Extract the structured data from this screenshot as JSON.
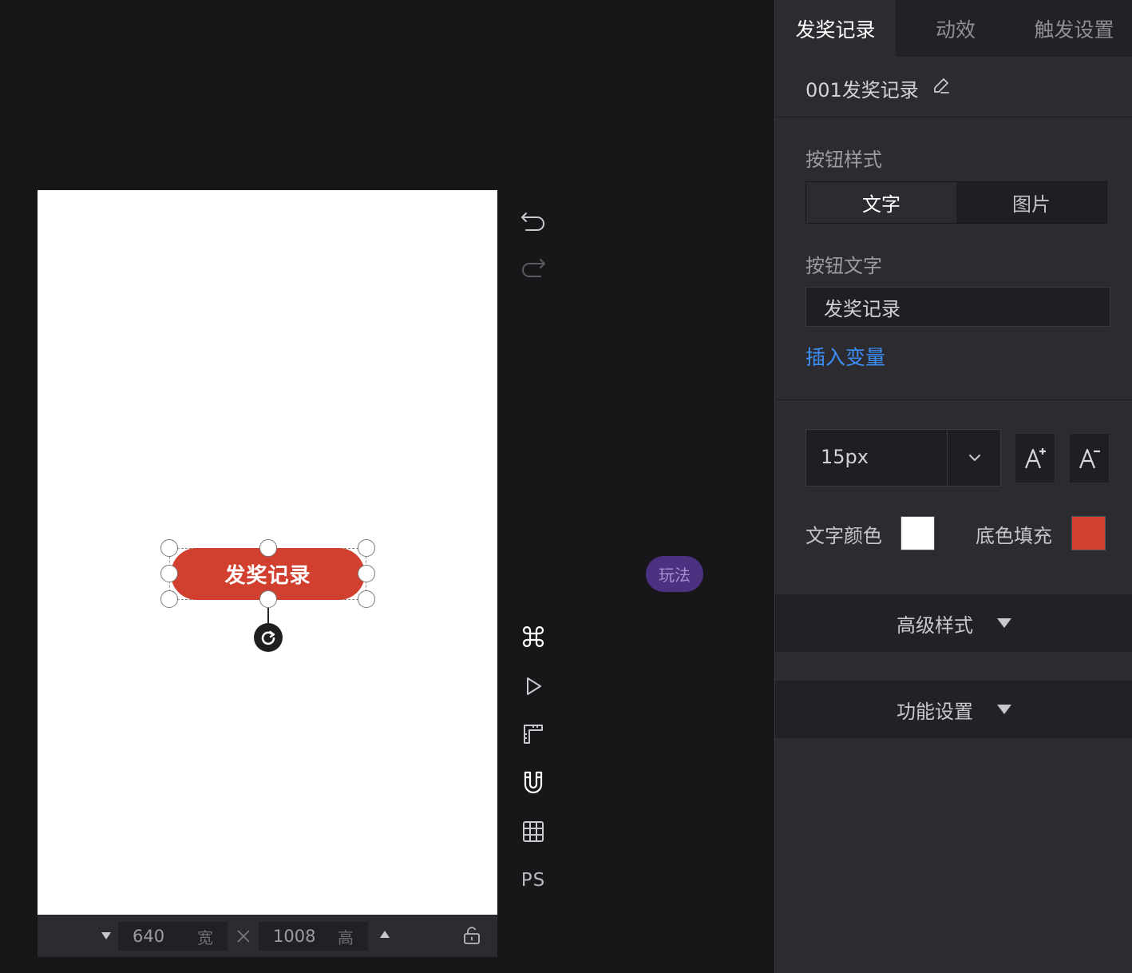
{
  "canvas": {
    "button_text": "发奖记录",
    "width_value": "640",
    "width_unit": "宽",
    "height_value": "1008",
    "height_unit": "高",
    "toolbar": {
      "ps_label": "PS"
    },
    "play_badge": "玩法"
  },
  "panel": {
    "tabs": [
      {
        "label": "发奖记录",
        "active": true
      },
      {
        "label": "动效",
        "active": false
      },
      {
        "label": "触发设置",
        "active": false
      }
    ],
    "component_name": "001发奖记录",
    "button_style_label": "按钮样式",
    "style_options": [
      {
        "label": "文字",
        "active": true
      },
      {
        "label": "图片",
        "active": false
      }
    ],
    "button_text_label": "按钮文字",
    "button_text_value": "发奖记录",
    "insert_variable": "插入变量",
    "font_size": "15px",
    "text_color_label": "文字颜色",
    "text_color": "#ffffff",
    "fill_label": "底色填充",
    "fill_color": "#d13f2f",
    "advanced_style": "高级样式",
    "function_settings": "功能设置"
  },
  "colors": {
    "accent_link": "#3e8ef7",
    "badge": "#4b3180"
  }
}
